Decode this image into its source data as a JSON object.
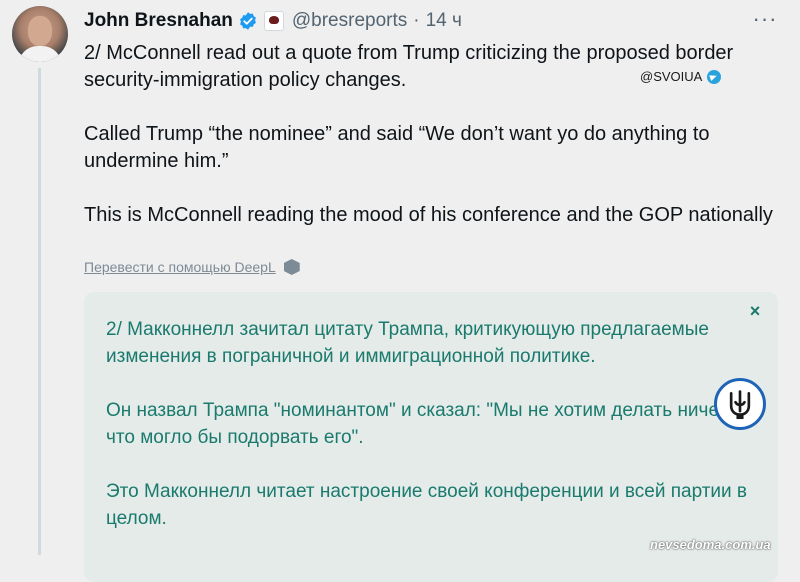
{
  "tweet": {
    "author": "John Bresnahan",
    "handle": "@bresreports",
    "separator": "·",
    "time": "14 ч",
    "more_label": "···",
    "paragraphs": [
      "2/ McConnell read out a quote from Trump criticizing the proposed border security-immigration policy changes.",
      "Called Trump “the nominee” and said “We don’t want yo do anything to undermine him.”",
      "This is McConnell reading the mood of his conference and the GOP nationally"
    ],
    "translate_link": "Перевести с помощью DeepL"
  },
  "translation": {
    "close_label": "×",
    "paragraphs": [
      "2/ Макконнелл зачитал цитату Трампа, критикующую предлагаемые изменения в пограничной и иммиграционной политике.",
      "Он назвал Трампа \"номинантом\" и сказал: \"Мы не хотим делать ничего, что могло бы подорвать его\".",
      "Это Макконнелл читает настроение своей конференции и всей партии в целом."
    ]
  },
  "watermarks": {
    "telegram": "@SVOIUA",
    "site": "nevsedoma.com.ua"
  },
  "icons": {
    "verified": "verified-badge-icon",
    "affiliation": "affiliation-badge-icon",
    "deepl": "deepl-icon",
    "telegram": "telegram-icon",
    "emblem": "trident-emblem-icon"
  },
  "colors": {
    "verified": "#1d9bf0",
    "translation_text": "#1a7a6e",
    "translation_bg": "#e4ebe8",
    "secondary_text": "#536471"
  }
}
